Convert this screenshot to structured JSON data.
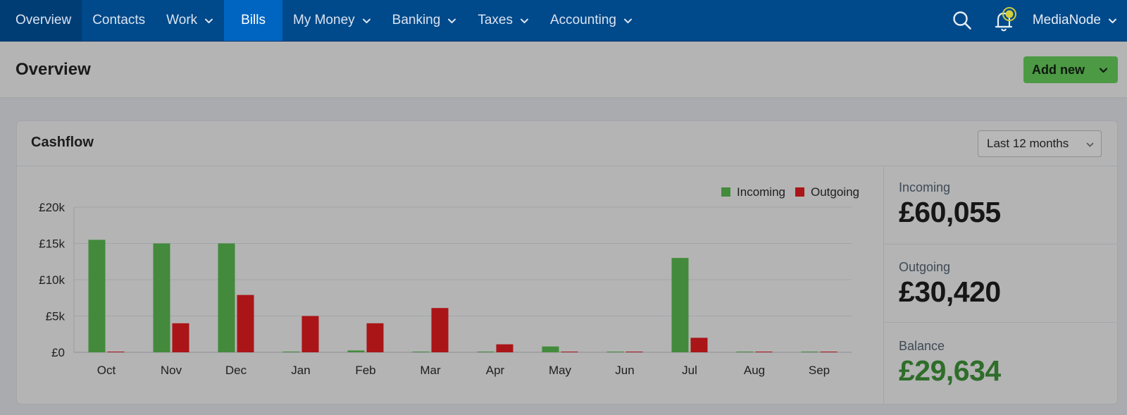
{
  "nav": {
    "items": [
      {
        "label": "Overview",
        "dropdown": false
      },
      {
        "label": "Contacts",
        "dropdown": false
      },
      {
        "label": "Work",
        "dropdown": true
      },
      {
        "label": "Bills",
        "dropdown": false
      },
      {
        "label": "My Money",
        "dropdown": true
      },
      {
        "label": "Banking",
        "dropdown": true
      },
      {
        "label": "Taxes",
        "dropdown": true
      },
      {
        "label": "Accounting",
        "dropdown": true
      }
    ],
    "active": "Bills",
    "account_name": "MediaNode",
    "search_icon": "search-icon",
    "notification_icon": "bell-icon",
    "colors": {
      "nav_bg": "#00498a",
      "active_tab": "#0065c0"
    }
  },
  "page": {
    "title": "Overview",
    "add_new_label": "Add new"
  },
  "cashflow": {
    "title": "Cashflow",
    "period": "Last 12 months",
    "stats": {
      "incoming_label": "Incoming",
      "incoming_value": "£60,055",
      "outgoing_label": "Outgoing",
      "outgoing_value": "£30,420",
      "balance_label": "Balance",
      "balance_value": "£29,634"
    }
  },
  "chart_data": {
    "type": "bar",
    "categories": [
      "Oct",
      "Nov",
      "Dec",
      "Jan",
      "Feb",
      "Mar",
      "Apr",
      "May",
      "Jun",
      "Jul",
      "Aug",
      "Sep"
    ],
    "series": [
      {
        "name": "Incoming",
        "color": "#438a3c",
        "values": [
          15500,
          15000,
          15000,
          100,
          250,
          50,
          100,
          800,
          50,
          13000,
          50,
          50
        ]
      },
      {
        "name": "Outgoing",
        "color": "#aa1518",
        "values": [
          50,
          4000,
          7900,
          5000,
          4000,
          6100,
          1100,
          50,
          50,
          2000,
          50,
          50
        ]
      }
    ],
    "y_ticks": [
      "£0",
      "£5k",
      "£10k",
      "£15k",
      "£20k"
    ],
    "y_tick_values": [
      0,
      5000,
      10000,
      15000,
      20000
    ],
    "ylim": [
      0,
      20000
    ],
    "grid": true,
    "legend": "top-right"
  }
}
